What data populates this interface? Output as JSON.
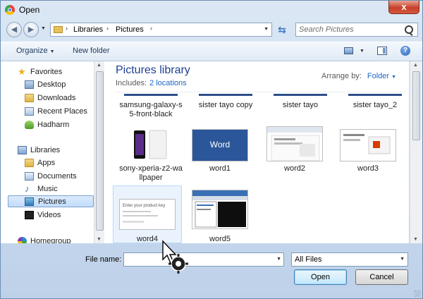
{
  "window": {
    "title": "Open",
    "close_label": "x"
  },
  "address": {
    "breadcrumbs": [
      "Libraries",
      "Pictures"
    ],
    "separator": "›",
    "refresh_glyph": "⇆",
    "search_placeholder": "Search Pictures"
  },
  "toolbar": {
    "organize_label": "Organize",
    "new_folder_label": "New folder",
    "help_label": "?"
  },
  "nav": {
    "favorites": {
      "label": "Favorites",
      "items": [
        "Desktop",
        "Downloads",
        "Recent Places",
        "Hadharm"
      ]
    },
    "libraries": {
      "label": "Libraries",
      "items": [
        "Apps",
        "Documents",
        "Music",
        "Pictures",
        "Videos"
      ],
      "selected": "Pictures"
    },
    "homegroup": {
      "label": "Homegroup"
    }
  },
  "content": {
    "title": "Pictures library",
    "includes_label": "Includes:",
    "includes_link": "2 locations",
    "arrange_label": "Arrange by:",
    "arrange_value": "Folder",
    "top_row": [
      "samsung-galaxy-s5-front-black",
      "sister tayo copy",
      "sister tayo",
      "sister tayo_2"
    ],
    "top_row_display": [
      "samsung-galaxy-s",
      "5-front-black"
    ],
    "middle_row": [
      "sony-xperia-z2-wallpaper",
      "word1",
      "word2",
      "word3"
    ],
    "middle_row_display": [
      "sony-xperia-z2-wa",
      "llpaper"
    ],
    "bottom_row": [
      "word4",
      "word5"
    ],
    "word1_thumb_text": "Word",
    "word4_thumb_text": "Enter your product key"
  },
  "bottom": {
    "file_name_label": "File name:",
    "file_name_value": "",
    "filter_value": "All Files",
    "open_label": "Open",
    "cancel_label": "Cancel"
  }
}
